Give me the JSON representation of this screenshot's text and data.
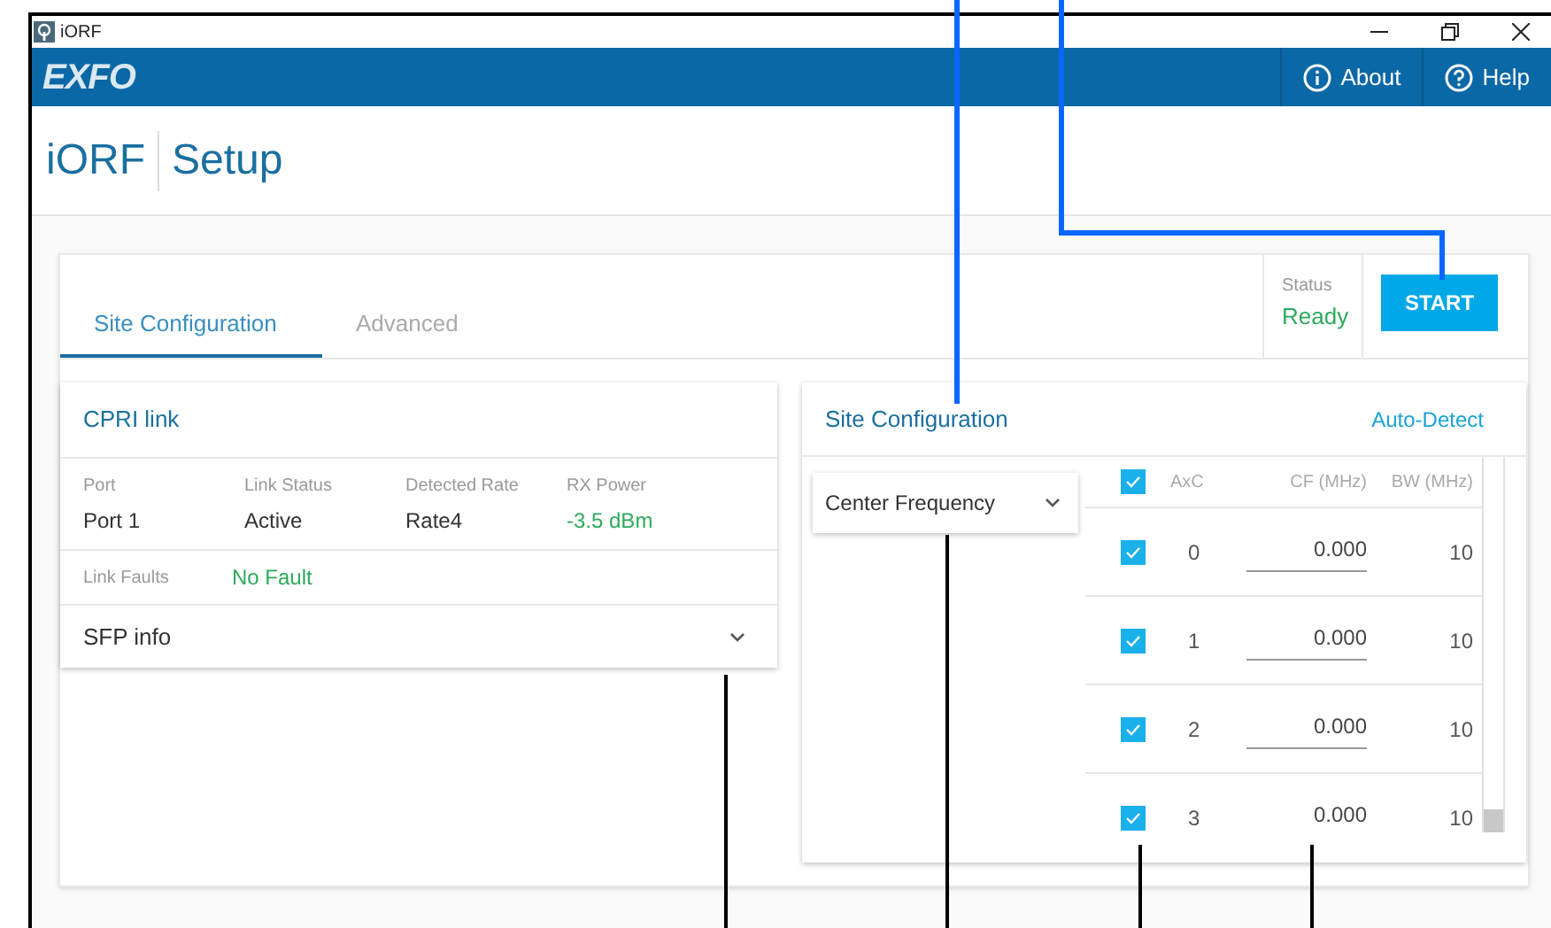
{
  "window": {
    "title": "iORF",
    "logo": "EXFO"
  },
  "header_buttons": [
    {
      "label": "About",
      "kind": "info"
    },
    {
      "label": "Help",
      "kind": "help"
    }
  ],
  "page_title": {
    "app": "iORF",
    "section": "Setup"
  },
  "tabs": [
    {
      "label": "Site Configuration",
      "selected": true
    },
    {
      "label": "Advanced",
      "selected": false
    }
  ],
  "status": {
    "label": "Status",
    "value": "Ready"
  },
  "start_button": "START",
  "cpri_link": {
    "title": "CPRI link",
    "fields": [
      {
        "label": "Port",
        "value": "Port 1",
        "color": "#333333"
      },
      {
        "label": "Link Status",
        "value": "Active",
        "color": "#333333"
      },
      {
        "label": "Detected Rate",
        "value": "Rate4",
        "color": "#333333"
      },
      {
        "label": "RX Power",
        "value": "-3.5 dBm",
        "color": "#2eaa5c"
      }
    ],
    "faults": {
      "label": "Link Faults",
      "value": "No Fault"
    },
    "sfp": {
      "label": "SFP info",
      "expanded": false
    }
  },
  "site_configuration": {
    "title": "Site Configuration",
    "auto_detect": "Auto-Detect",
    "mode_select": {
      "value": "Center Frequency"
    },
    "table": {
      "all_checked": true,
      "columns": [
        "AxC",
        "CF (MHz)",
        "BW (MHz)"
      ],
      "rows": [
        {
          "checked": true,
          "axc": "0",
          "cf": "0.000",
          "bw": "10",
          "editable": true
        },
        {
          "checked": true,
          "axc": "1",
          "cf": "0.000",
          "bw": "10",
          "editable": true
        },
        {
          "checked": true,
          "axc": "2",
          "cf": "0.000",
          "bw": "10",
          "editable": true
        },
        {
          "checked": true,
          "axc": "3",
          "cf": "0.000",
          "bw": "10",
          "editable": false
        }
      ]
    }
  }
}
